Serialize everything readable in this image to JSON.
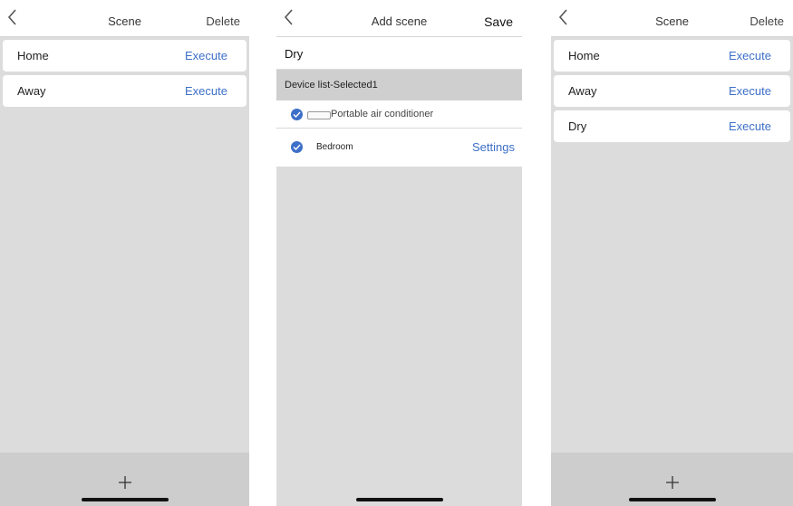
{
  "screen1": {
    "back_icon": "chevron-left-icon",
    "title": "Scene",
    "delete_label": "Delete",
    "scenes": [
      {
        "name": "Home",
        "action": "Execute"
      },
      {
        "name": "Away",
        "action": "Execute"
      }
    ],
    "add_icon": "plus-icon"
  },
  "screen2": {
    "back_icon": "chevron-left-icon",
    "title": "Add scene",
    "save_label": "Save",
    "scene_name_value": "Dry",
    "section_header": "Device list-Selected1",
    "device_type": "Portable air conditioner",
    "device_name": "Bedroom",
    "settings_label": "Settings"
  },
  "screen3": {
    "back_icon": "chevron-left-icon",
    "title": "Scene",
    "delete_label": "Delete",
    "scenes": [
      {
        "name": "Home",
        "action": "Execute"
      },
      {
        "name": "Away",
        "action": "Execute"
      },
      {
        "name": "Dry",
        "action": "Execute"
      }
    ],
    "add_icon": "plus-icon"
  },
  "colors": {
    "accent": "#3d6fc8",
    "background": "#dcdcdc",
    "footer": "#cdcdcd"
  }
}
